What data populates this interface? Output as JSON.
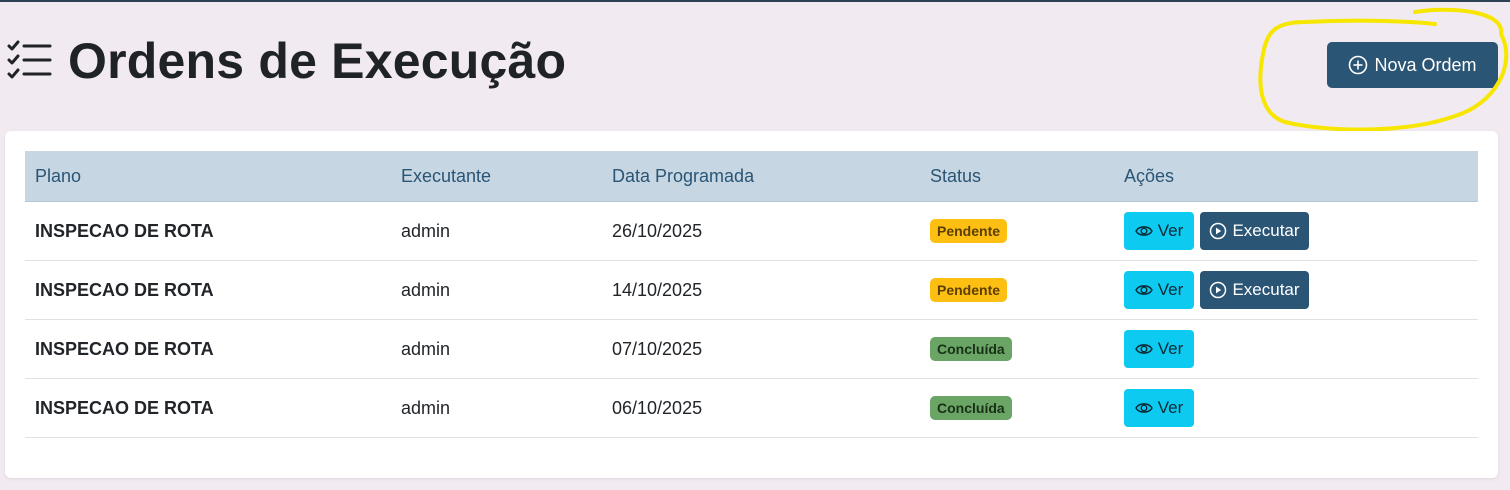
{
  "header": {
    "title": "Ordens de Execução",
    "new_button_label": "Nova Ordem"
  },
  "table": {
    "columns": [
      "Plano",
      "Executante",
      "Data Programada",
      "Status",
      "Ações"
    ],
    "rows": [
      {
        "plano": "INSPECAO DE ROTA",
        "executante": "admin",
        "data": "26/10/2025",
        "status": "Pendente",
        "ver": "Ver",
        "executar": "Executar"
      },
      {
        "plano": "INSPECAO DE ROTA",
        "executante": "admin",
        "data": "14/10/2025",
        "status": "Pendente",
        "ver": "Ver",
        "executar": "Executar"
      },
      {
        "plano": "INSPECAO DE ROTA",
        "executante": "admin",
        "data": "07/10/2025",
        "status": "Concluída",
        "ver": "Ver"
      },
      {
        "plano": "INSPECAO DE ROTA",
        "executante": "admin",
        "data": "06/10/2025",
        "status": "Concluída",
        "ver": "Ver"
      }
    ]
  },
  "colors": {
    "primary": "#2b5575",
    "info": "#0dcaf0",
    "warning": "#fcbf12",
    "success": "#6aa566",
    "highlight": "#f7e600"
  },
  "icons": {
    "title": "list-check-icon",
    "new": "plus-circle-icon",
    "view": "eye-icon",
    "execute": "play-circle-icon"
  }
}
